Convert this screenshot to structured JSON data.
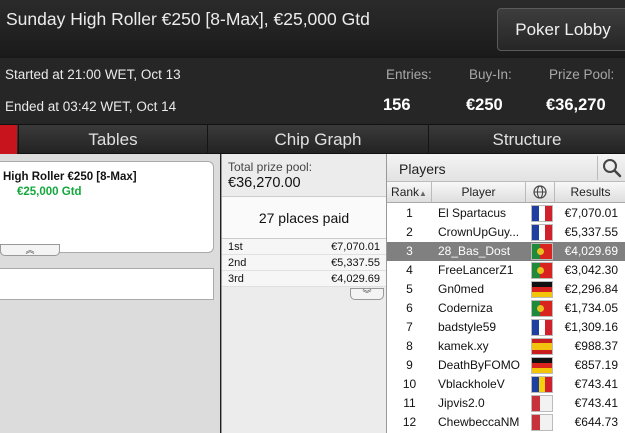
{
  "header": {
    "title": "Sunday High Roller €250 [8-Max], €25,000 Gtd",
    "lobby_button": "Poker Lobby"
  },
  "info": {
    "started": "Started at 21:00 WET, Oct 13",
    "ended": "Ended at 03:42 WET, Oct 14",
    "entries_label": "Entries:",
    "entries_value": "156",
    "buyin_label": "Buy-In:",
    "buyin_value": "€250",
    "prizepool_label": "Prize Pool:",
    "prizepool_value": "€36,270"
  },
  "tabs": [
    "Tables",
    "Chip Graph",
    "Structure"
  ],
  "left_panel": {
    "card_name": "High Roller €250 [8-Max]",
    "card_gtd": "€25,000 Gtd",
    "collapse_icon": "double-chevron-up-icon"
  },
  "prize_panel": {
    "pool_label": "Total prize pool:",
    "pool_value": "€36,270.00",
    "places_paid": "27 places paid",
    "payouts": [
      {
        "place": "1st",
        "amount": "€7,070.01"
      },
      {
        "place": "2nd",
        "amount": "€5,337.55"
      },
      {
        "place": "3rd",
        "amount": "€4,029.69"
      }
    ]
  },
  "players_panel": {
    "title": "Players",
    "search_icon": "magnifier-icon",
    "col_rank": "Rank",
    "col_player": "Player",
    "col_country_icon": "globe-icon",
    "col_results": "Results",
    "selected_row": 2,
    "rows": [
      {
        "rank": "1",
        "player": "El Spartacus",
        "flag": "france",
        "result": "€7,070.01"
      },
      {
        "rank": "2",
        "player": "CrownUpGuy...",
        "flag": "france",
        "result": "€5,337.55"
      },
      {
        "rank": "3",
        "player": "28_Bas_Dost",
        "flag": "portugal",
        "result": "€4,029.69"
      },
      {
        "rank": "4",
        "player": "FreeLancerZ1",
        "flag": "portugal",
        "result": "€3,042.30"
      },
      {
        "rank": "5",
        "player": "Gn0med",
        "flag": "germany",
        "result": "€2,296.84"
      },
      {
        "rank": "6",
        "player": "Coderniza",
        "flag": "portugal",
        "result": "€1,734.05"
      },
      {
        "rank": "7",
        "player": "badstyle59",
        "flag": "france",
        "result": "€1,309.16"
      },
      {
        "rank": "8",
        "player": "kamek.xy",
        "flag": "spain",
        "result": "€988.37"
      },
      {
        "rank": "9",
        "player": "DeathByFOMO",
        "flag": "germany",
        "result": "€857.19"
      },
      {
        "rank": "10",
        "player": "VblackholeV",
        "flag": "romania",
        "result": "€743.41"
      },
      {
        "rank": "11",
        "player": "Jipvis2.0",
        "flag": "generic",
        "result": "€743.41"
      },
      {
        "rank": "12",
        "player": "ChewbeccaNM",
        "flag": "generic",
        "result": "€644.73"
      }
    ]
  }
}
